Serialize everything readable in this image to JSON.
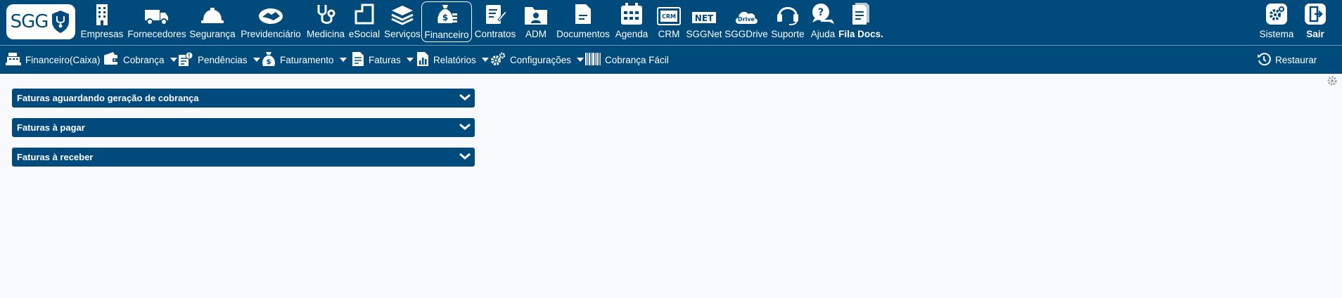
{
  "logo": {
    "text": "SGG"
  },
  "nav": [
    {
      "id": "empresas",
      "label": "Empresas",
      "icon": "building-icon"
    },
    {
      "id": "fornecedores",
      "label": "Fornecedores",
      "icon": "truck-icon"
    },
    {
      "id": "seguranca",
      "label": "Segurança",
      "icon": "hard-hat-icon"
    },
    {
      "id": "previdenciario",
      "label": "Previdenciário",
      "icon": "handshake-icon"
    },
    {
      "id": "medicina",
      "label": "Medicina",
      "icon": "stethoscope-icon"
    },
    {
      "id": "esocial",
      "label": "eSocial",
      "icon": "esocial-icon"
    },
    {
      "id": "servicos",
      "label": "Serviços",
      "icon": "layers-icon"
    },
    {
      "id": "financeiro",
      "label": "Financeiro",
      "icon": "money-bag-icon"
    },
    {
      "id": "contratos",
      "label": "Contratos",
      "icon": "contract-icon"
    },
    {
      "id": "adm",
      "label": "ADM",
      "icon": "folder-user-icon"
    },
    {
      "id": "documentos",
      "label": "Documentos",
      "icon": "document-icon"
    },
    {
      "id": "agenda",
      "label": "Agenda",
      "icon": "calendar-icon"
    },
    {
      "id": "crm",
      "label": "CRM",
      "icon": "crm-icon"
    },
    {
      "id": "sggnet",
      "label": "SGGNet",
      "icon": "net-icon"
    },
    {
      "id": "sggdrive",
      "label": "SGGDrive",
      "icon": "cloud-drive-icon"
    },
    {
      "id": "suporte",
      "label": "Suporte",
      "icon": "headset-icon"
    },
    {
      "id": "ajuda",
      "label": "Ajuda",
      "icon": "help-chat-icon"
    },
    {
      "id": "filadocs",
      "label": "Fila Docs.",
      "icon": "documents-queue-icon"
    }
  ],
  "nav_right": [
    {
      "id": "sistema",
      "label": "Sistema",
      "icon": "settings-icon"
    },
    {
      "id": "sair",
      "label": "Sair",
      "icon": "exit-icon"
    }
  ],
  "active_nav": "Financeiro",
  "subnav": [
    {
      "id": "caixa",
      "label": "Financeiro(Caixa)",
      "icon": "cash-register-icon",
      "dropdown": false
    },
    {
      "id": "cobranca",
      "label": "Cobrança",
      "icon": "wallet-icon",
      "dropdown": true
    },
    {
      "id": "pendencias",
      "label": "Pendências",
      "icon": "pending-icon",
      "dropdown": true
    },
    {
      "id": "faturamento",
      "label": "Faturamento",
      "icon": "money-bag-icon",
      "dropdown": true
    },
    {
      "id": "faturas",
      "label": "Faturas",
      "icon": "invoice-icon",
      "dropdown": true
    },
    {
      "id": "relatorios",
      "label": "Relatórios",
      "icon": "report-chart-icon",
      "dropdown": true
    },
    {
      "id": "configuracoes",
      "label": "Configurações",
      "icon": "gears-icon",
      "dropdown": true
    },
    {
      "id": "cobrancafacil",
      "label": "Cobrança Fácil",
      "icon": "barcode-icon",
      "dropdown": false
    }
  ],
  "subnav_right": {
    "label": "Restaurar",
    "icon": "restore-icon"
  },
  "panels": [
    {
      "title": "Faturas aguardando geração de cobrança"
    },
    {
      "title": "Faturas à pagar"
    },
    {
      "title": "Faturas à receber"
    }
  ],
  "colors": {
    "primary": "#004a7c",
    "background": "#f7f9fc",
    "text_on_primary": "#ffffff"
  }
}
